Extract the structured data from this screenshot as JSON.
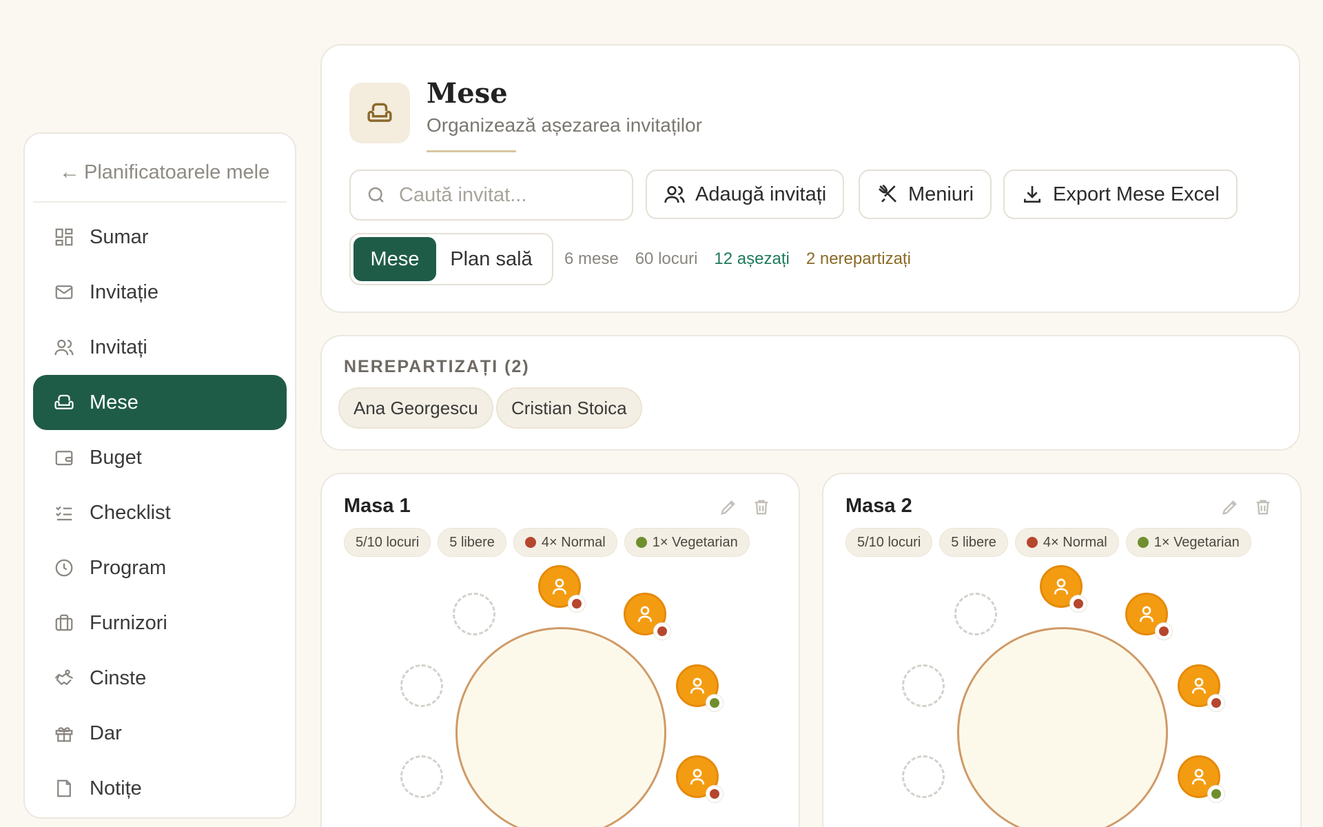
{
  "sidebar": {
    "back_label": "Planificatoarele mele",
    "items": [
      {
        "label": "Sumar",
        "icon": "dashboard-icon"
      },
      {
        "label": "Invitație",
        "icon": "envelope-icon"
      },
      {
        "label": "Invitați",
        "icon": "users-icon"
      },
      {
        "label": "Mese",
        "icon": "armchair-icon",
        "active": true
      },
      {
        "label": "Buget",
        "icon": "wallet-icon"
      },
      {
        "label": "Checklist",
        "icon": "checklist-icon"
      },
      {
        "label": "Program",
        "icon": "clock-icon"
      },
      {
        "label": "Furnizori",
        "icon": "briefcase-icon"
      },
      {
        "label": "Cinste",
        "icon": "handshake-icon"
      },
      {
        "label": "Dar",
        "icon": "gift-icon"
      },
      {
        "label": "Notițe",
        "icon": "note-icon"
      }
    ]
  },
  "header": {
    "title": "Mese",
    "subtitle": "Organizează așezarea invitaților",
    "search_placeholder": "Caută invitat...",
    "buttons": {
      "add_guests": "Adaugă invitați",
      "menus": "Meniuri",
      "export": "Export Mese Excel"
    },
    "view_toggle": {
      "tables": "Mese",
      "floor_plan": "Plan sală"
    },
    "stats": {
      "tables": "6 mese",
      "seats": "60 locuri",
      "seated": "12 așezați",
      "unassigned": "2 nerepartizați"
    }
  },
  "unassigned": {
    "title": "NEREPARTIZAȚI (2)",
    "guests": [
      "Ana Georgescu",
      "Cristian Stoica"
    ]
  },
  "tables": [
    {
      "name": "Masa 1",
      "badges": {
        "seats": "5/10 locuri",
        "free": "5 libere",
        "normal": "4× Normal",
        "vegetarian": "1× Vegetarian"
      }
    },
    {
      "name": "Masa 2",
      "badges": {
        "seats": "5/10 locuri",
        "free": "5 libere",
        "normal": "4× Normal",
        "vegetarian": "1× Vegetarian"
      }
    }
  ],
  "colors": {
    "accent": "#1f5c48",
    "seat_filled": "#f39c12",
    "seated_text": "#1e7a5a",
    "unassigned_text": "#8a6a24",
    "meat_dot": "#b5472e",
    "veg_dot": "#6f8f2e"
  }
}
